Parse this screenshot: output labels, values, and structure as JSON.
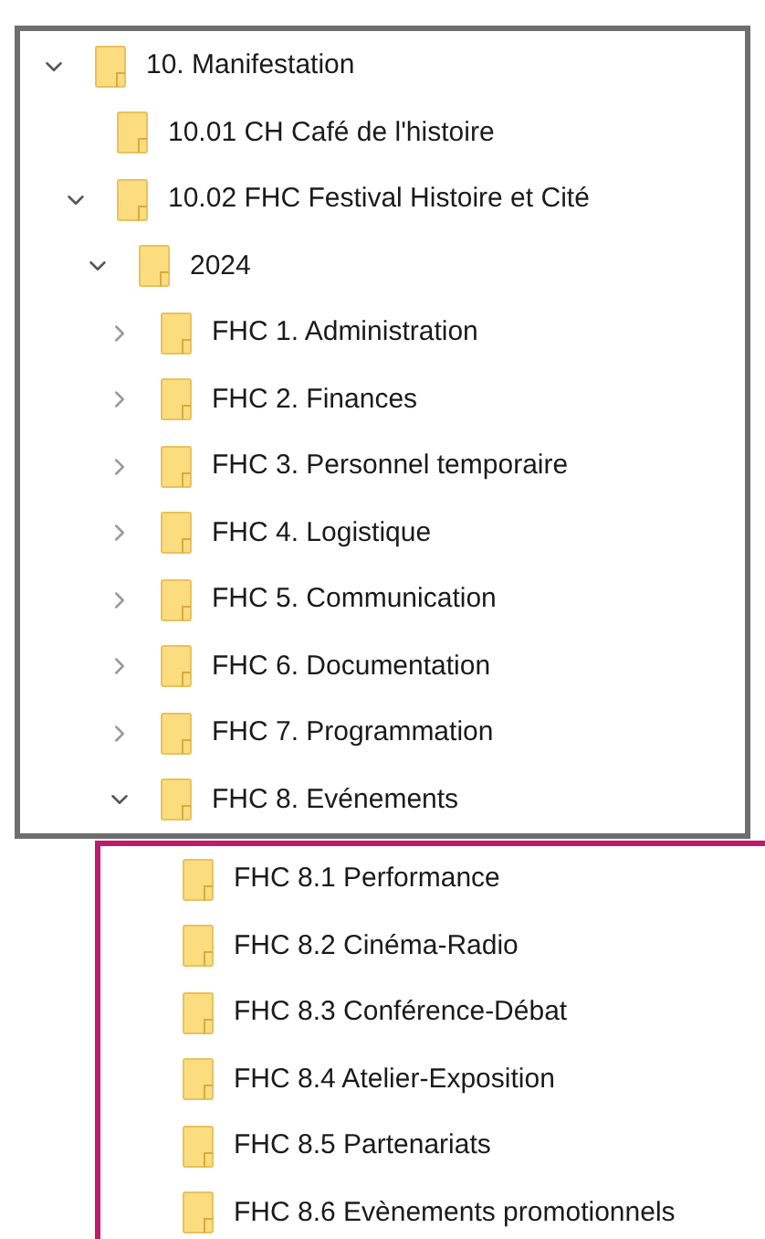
{
  "folder_tree": {
    "items": [
      {
        "label": "10. Manifestation",
        "expanded": true,
        "children": [
          {
            "label": "10.01 CH Café de l'histoire"
          },
          {
            "label": "10.02 FHC Festival Histoire et Cité",
            "expanded": true,
            "children": [
              {
                "label": "2024",
                "expanded": true,
                "children": [
                  {
                    "label": "FHC 1. Administration",
                    "expanded": false
                  },
                  {
                    "label": "FHC 2. Finances",
                    "expanded": false
                  },
                  {
                    "label": "FHC 3. Personnel temporaire",
                    "expanded": false
                  },
                  {
                    "label": "FHC 4. Logistique",
                    "expanded": false
                  },
                  {
                    "label": "FHC 5. Communication",
                    "expanded": false
                  },
                  {
                    "label": "FHC 6. Documentation",
                    "expanded": false
                  },
                  {
                    "label": "FHC 7. Programmation",
                    "expanded": false
                  },
                  {
                    "label": "FHC 8. Evénements",
                    "expanded": true
                  }
                ]
              }
            ]
          }
        ]
      }
    ]
  },
  "highlighted_subfolders": {
    "items": [
      {
        "label": "FHC 8.1 Performance"
      },
      {
        "label": "FHC 8.2 Cinéma-Radio"
      },
      {
        "label": "FHC 8.3 Conférence-Débat"
      },
      {
        "label": "FHC 8.4 Atelier-Exposition"
      },
      {
        "label": "FHC 8.5 Partenariats"
      },
      {
        "label": "FHC 8.6 Evènements promotionnels"
      }
    ]
  }
}
